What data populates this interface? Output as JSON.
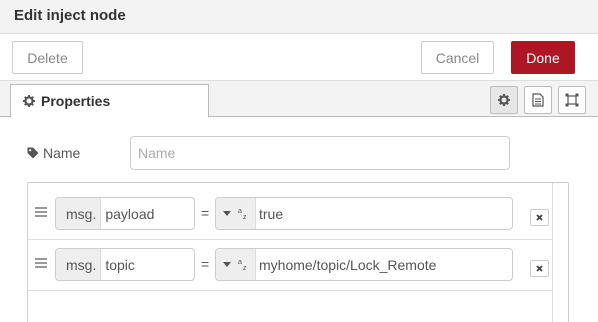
{
  "header": {
    "title": "Edit inject node"
  },
  "toolbar": {
    "delete_label": "Delete",
    "cancel_label": "Cancel",
    "done_label": "Done"
  },
  "tabs": {
    "properties_label": "Properties"
  },
  "tab_icons": [
    "gear-icon",
    "document-icon",
    "layout-icon"
  ],
  "name_field": {
    "label": "Name",
    "placeholder": "Name",
    "value": ""
  },
  "properties": [
    {
      "prefix": "msg.",
      "name": "payload",
      "operator": "=",
      "type_icon": "string-type-icon",
      "value": "true"
    },
    {
      "prefix": "msg.",
      "name": "topic",
      "operator": "=",
      "type_icon": "string-type-icon",
      "value": "myhome/topic/Lock_Remote"
    }
  ],
  "colors": {
    "accent": "#ad1625",
    "header_bg": "#f3f3f3",
    "border": "#cccccc"
  }
}
